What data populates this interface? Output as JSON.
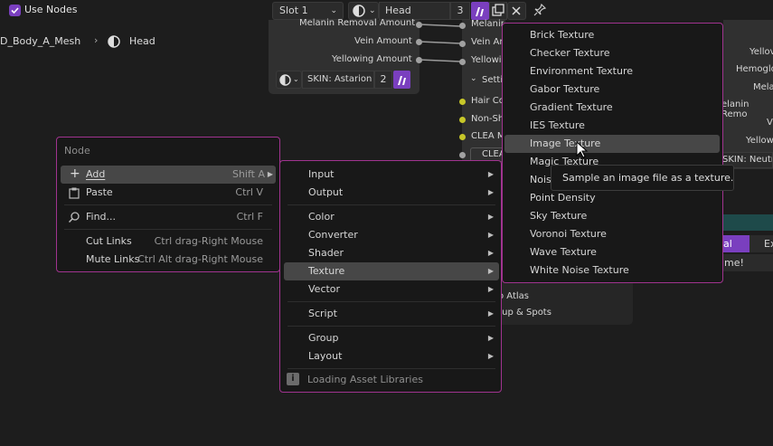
{
  "colors": {
    "accent": "#a0338f",
    "bg": "#1d1d1d",
    "menu_bg": "#181818",
    "highlight": "#474747",
    "socket_grey": "#a1a1a1",
    "socket_yellow": "#c7c729",
    "purple_btn": "#7a3fbf"
  },
  "header": {
    "use_nodes_label": "Use Nodes",
    "use_nodes_checked": true,
    "slot": "Slot 1",
    "material_name": "Head",
    "user_count": "3",
    "pin_icon": "pin-icon"
  },
  "breadcrumb": {
    "mesh": "D_Body_A_Mesh",
    "material": "Head"
  },
  "node_group": {
    "sockets": [
      "Melanin Removal Amount",
      "Vein Amount",
      "Yellowing Amount"
    ],
    "skin_name": "SKIN: Astarion",
    "skin_users": "2"
  },
  "node_right": {
    "sockets": [
      "Melanin Removal Amount",
      "Vein Amount",
      "Yellowing"
    ],
    "panel": "Settings",
    "yellow_sockets": [
      "Hair Color",
      "Non-Shiny",
      "CLEA M"
    ],
    "clea": "CLEA"
  },
  "far_right": {
    "labels": [
      "Yellov",
      "Hemoglo",
      "Mela",
      "elanin Remo",
      "V",
      "Yellow"
    ],
    "skin": "SKIN: Neutr.",
    "tab_a": "al",
    "tab_b": "Ex",
    "note": "me!"
  },
  "below_node": {
    "items": [
      "o Atlas",
      "eup & Spots"
    ]
  },
  "node_menu": {
    "title": "Node",
    "items": [
      {
        "icon": "plus-icon",
        "label": "Add",
        "shortcut": "Shift A",
        "submenu": true,
        "highlighted": true
      },
      {
        "icon": "paste-icon",
        "label": "Paste",
        "shortcut": "Ctrl V"
      },
      {
        "icon": "search-icon",
        "label": "Find...",
        "shortcut": "Ctrl F"
      },
      {
        "label": "Cut Links",
        "shortcut": "Ctrl drag-Right Mouse"
      },
      {
        "label": "Mute Links",
        "shortcut": "Ctrl Alt drag-Right Mouse"
      }
    ]
  },
  "add_menu": {
    "items": [
      "Input",
      "Output",
      "Color",
      "Converter",
      "Shader",
      "Texture",
      "Vector",
      "Script",
      "Group",
      "Layout"
    ],
    "active": "Texture",
    "loading": "Loading Asset Libraries"
  },
  "texture_menu": {
    "items": [
      "Brick Texture",
      "Checker Texture",
      "Environment Texture",
      "Gabor Texture",
      "Gradient Texture",
      "IES Texture",
      "Image Texture",
      "Magic Texture",
      "Noise Texture",
      "Point Density",
      "Sky Texture",
      "Voronoi Texture",
      "Wave Texture",
      "White Noise Texture"
    ],
    "hovered": "Image Texture"
  },
  "tooltip": {
    "text": "Sample an image file as a texture."
  }
}
